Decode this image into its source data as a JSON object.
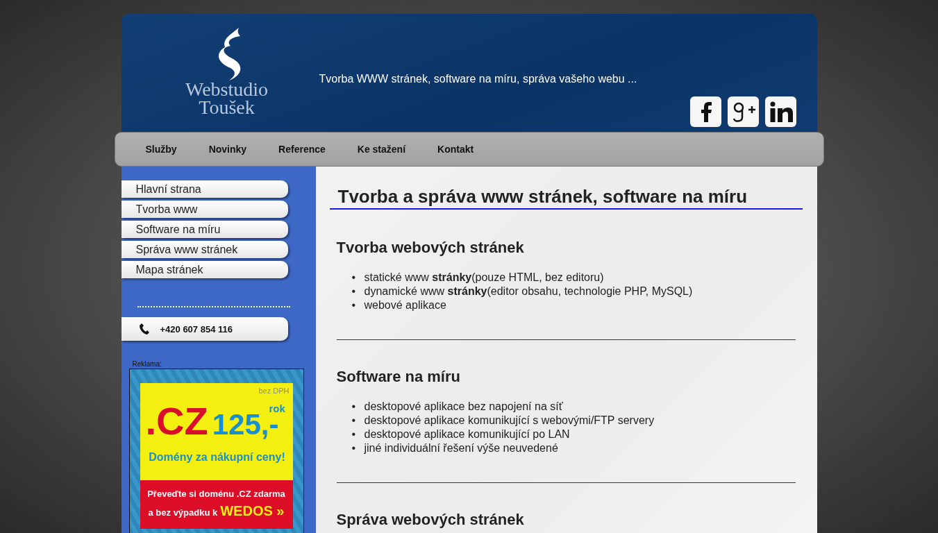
{
  "header": {
    "logo_lines": [
      "Webstudio",
      "Toušek"
    ],
    "tagline": "Tvorba WWW stránek, software na míru, správa vašeho webu ..."
  },
  "nav": {
    "items": [
      "Služby",
      "Novinky",
      "Reference",
      "Ke stažení",
      "Kontakt"
    ]
  },
  "sidebar": {
    "menu": [
      "Hlavní strana",
      "Tvorba www",
      "Software na míru",
      "Správa www stránek",
      "Mapa stránek"
    ],
    "phone": "+420 607 854 116",
    "ad_label": "Reklama:",
    "ad": {
      "note": "bez DPH",
      "domain": ".CZ",
      "price": "125,-",
      "unit": "rok",
      "slogan": "Domény za nákupní ceny!",
      "offer_line1": "Převeďte si doménu .CZ zdarma",
      "offer_line2": "a bez výpadku k",
      "brand": "WEDOS »"
    }
  },
  "content": {
    "title": "Tvorba a správa www stránek, software na míru",
    "sections": [
      {
        "heading": "Tvorba webových stránek",
        "items": [
          {
            "bullet": "•",
            "text": "statické www **stránky**(pouze HTML, bez editoru)"
          },
          {
            "bullet": "•",
            "text": "dynamické www **stránky**(editor obsahu, technologie PHP, MySQL)"
          },
          {
            "bullet": "•",
            "text": "webové aplikace"
          }
        ]
      },
      {
        "heading": "Software na míru",
        "items": [
          {
            "bullet": "•",
            "text": "desktopové aplikace bez napojení na síť"
          },
          {
            "bullet": "•",
            "text": "desktopové aplikace komunikující s webovými/FTP servery"
          },
          {
            "bullet": "•",
            "text": "desktopové aplikace komunikující po LAN"
          },
          {
            "bullet": "•",
            "text": "jiné individuální řešení výše neuvedené"
          }
        ]
      },
      {
        "heading": "Správa webových stránek"
      }
    ]
  }
}
